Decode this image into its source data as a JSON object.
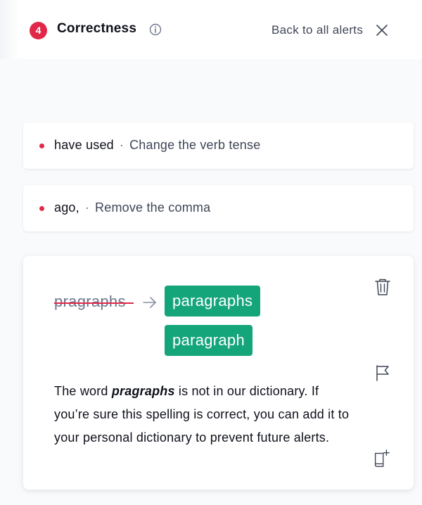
{
  "header": {
    "alert_count": "4",
    "title": "Correctness",
    "back_label": "Back to all alerts"
  },
  "alerts": [
    {
      "word": "have used",
      "separator": "·",
      "hint": "Change the verb tense"
    },
    {
      "word": "ago,",
      "separator": "·",
      "hint": "Remove the comma"
    }
  ],
  "expanded": {
    "original": "pragraphs",
    "suggestions": [
      "paragraphs",
      "paragraph"
    ],
    "explanation": {
      "part1": "The word ",
      "word": "pragraphs",
      "part2": " is not in our dictionary. If you’re sure this spelling is correct, you can add it to your personal dictionary to prevent future alerts."
    }
  },
  "colors": {
    "accent_red": "#e22848",
    "suggestion_green": "#15a57b",
    "text_dark": "#0e101a",
    "text_muted": "#404657"
  },
  "icons": [
    "info-icon",
    "close-icon",
    "arrow-right-icon",
    "trash-icon",
    "flag-icon",
    "add-to-dictionary-icon"
  ]
}
